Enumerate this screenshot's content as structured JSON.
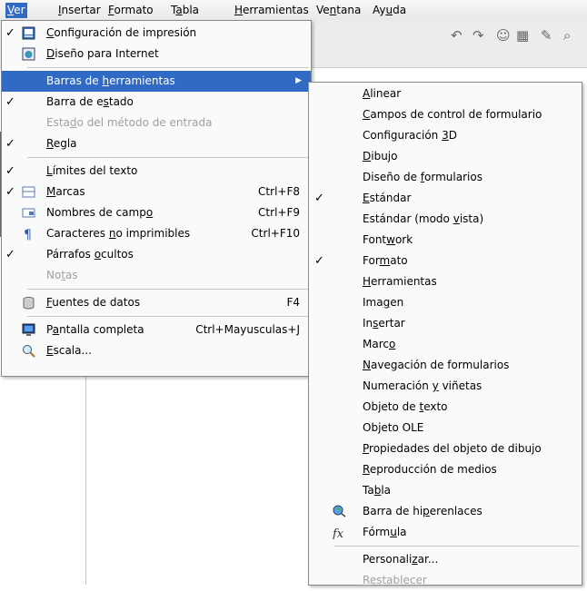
{
  "menubar": [
    {
      "pre": "",
      "u": "V",
      "post": "er",
      "active": true
    },
    {
      "pre": "",
      "u": "I",
      "post": "nsertar",
      "active": false
    },
    {
      "pre": "",
      "u": "F",
      "post": "ormato",
      "active": false
    },
    {
      "pre": "T",
      "u": "a",
      "post": "bla",
      "active": false
    },
    {
      "pre": "",
      "u": "H",
      "post": "erramientas",
      "active": false
    },
    {
      "pre": "Ve",
      "u": "n",
      "post": "tana",
      "active": false
    },
    {
      "pre": "Ay",
      "u": "u",
      "post": "da",
      "active": false
    }
  ],
  "ver_menu": [
    {
      "pre": "",
      "u": "C",
      "post": "onfiguración de impresión",
      "check": true,
      "icon": "print-layout-icon"
    },
    {
      "pre": "",
      "u": "D",
      "post": "iseño para Internet",
      "icon": "web-layout-icon"
    },
    {
      "sep": true
    },
    {
      "pre": "Barras de ",
      "u": "h",
      "post": "erramientas",
      "submenu": true,
      "highlight": true
    },
    {
      "pre": "Barra de e",
      "u": "s",
      "post": "tado",
      "check": true
    },
    {
      "pre": "Esta",
      "u": "d",
      "post": "o del método de entrada",
      "disabled": true
    },
    {
      "pre": "",
      "u": "R",
      "post": "egla",
      "check": true
    },
    {
      "sep": true
    },
    {
      "pre": "",
      "u": "L",
      "post": "ímites del texto",
      "check": true
    },
    {
      "pre": "",
      "u": "M",
      "post": "arcas",
      "check": true,
      "icon": "field-shadings-icon",
      "accel": "Ctrl+F8"
    },
    {
      "pre": "Nombres de camp",
      "u": "o",
      "post": "",
      "icon": "field-names-icon",
      "accel": "Ctrl+F9"
    },
    {
      "pre": "Caracteres ",
      "u": "n",
      "post": "o imprimibles",
      "icon": "pilcrow-icon",
      "accel": "Ctrl+F10"
    },
    {
      "pre": "Párrafos ",
      "u": "o",
      "post": "cultos",
      "check": true
    },
    {
      "pre": "No",
      "u": "t",
      "post": "as",
      "disabled": true
    },
    {
      "sep": true
    },
    {
      "pre": "",
      "u": "F",
      "post": "uentes de datos",
      "icon": "database-icon",
      "accel": "F4"
    },
    {
      "sep": true
    },
    {
      "pre": "P",
      "u": "a",
      "post": "ntalla completa",
      "icon": "monitor-icon",
      "accel": "Ctrl+Mayusculas+J"
    },
    {
      "pre": "",
      "u": "E",
      "post": "scala...",
      "icon": "zoom-magnifier-icon"
    }
  ],
  "toolbars_submenu": [
    {
      "pre": "",
      "u": "A",
      "post": "linear"
    },
    {
      "pre": "",
      "u": "C",
      "post": "ampos de control de formulario"
    },
    {
      "pre": "Configuración ",
      "u": "3",
      "post": "D"
    },
    {
      "pre": "",
      "u": "D",
      "post": "ibujo"
    },
    {
      "pre": "Diseño de ",
      "u": "f",
      "post": "ormularios"
    },
    {
      "pre": "",
      "u": "E",
      "post": "stándar",
      "check": true
    },
    {
      "pre": "Estándar (modo ",
      "u": "v",
      "post": "ista)"
    },
    {
      "pre": "Font",
      "u": "w",
      "post": "ork"
    },
    {
      "pre": "For",
      "u": "m",
      "post": "ato",
      "check": true
    },
    {
      "pre": "",
      "u": "H",
      "post": "erramientas"
    },
    {
      "pre": "Ima",
      "u": "g",
      "post": "en"
    },
    {
      "pre": "In",
      "u": "s",
      "post": "ertar"
    },
    {
      "pre": "Marc",
      "u": "o",
      "post": ""
    },
    {
      "pre": "",
      "u": "N",
      "post": "avegación de formularios"
    },
    {
      "pre": "Numeración ",
      "u": "y",
      "post": " viñetas"
    },
    {
      "pre": "Objeto de ",
      "u": "t",
      "post": "exto"
    },
    {
      "pre": "Objeto OLE",
      "u": "",
      "post": ""
    },
    {
      "pre": "",
      "u": "P",
      "post": "ropiedades del objeto de dibujo"
    },
    {
      "pre": "",
      "u": "R",
      "post": "eproducción de medios"
    },
    {
      "pre": "Ta",
      "u": "b",
      "post": "la"
    },
    {
      "pre": "Barra de hi",
      "u": "p",
      "post": "erenlaces",
      "icon": "hyperlink-globe-icon"
    },
    {
      "pre": "Fórm",
      "u": "u",
      "post": "la",
      "icon": "formula-fx-icon"
    },
    {
      "sep": true
    },
    {
      "pre": "Personali",
      "u": "z",
      "post": "ar..."
    },
    {
      "pre": "",
      "u": "R",
      "post": "establecer",
      "disabled": true
    }
  ],
  "toolbar_glyphs": [
    "↶",
    "↷",
    "☺",
    "▦",
    "✎",
    "⌕"
  ]
}
